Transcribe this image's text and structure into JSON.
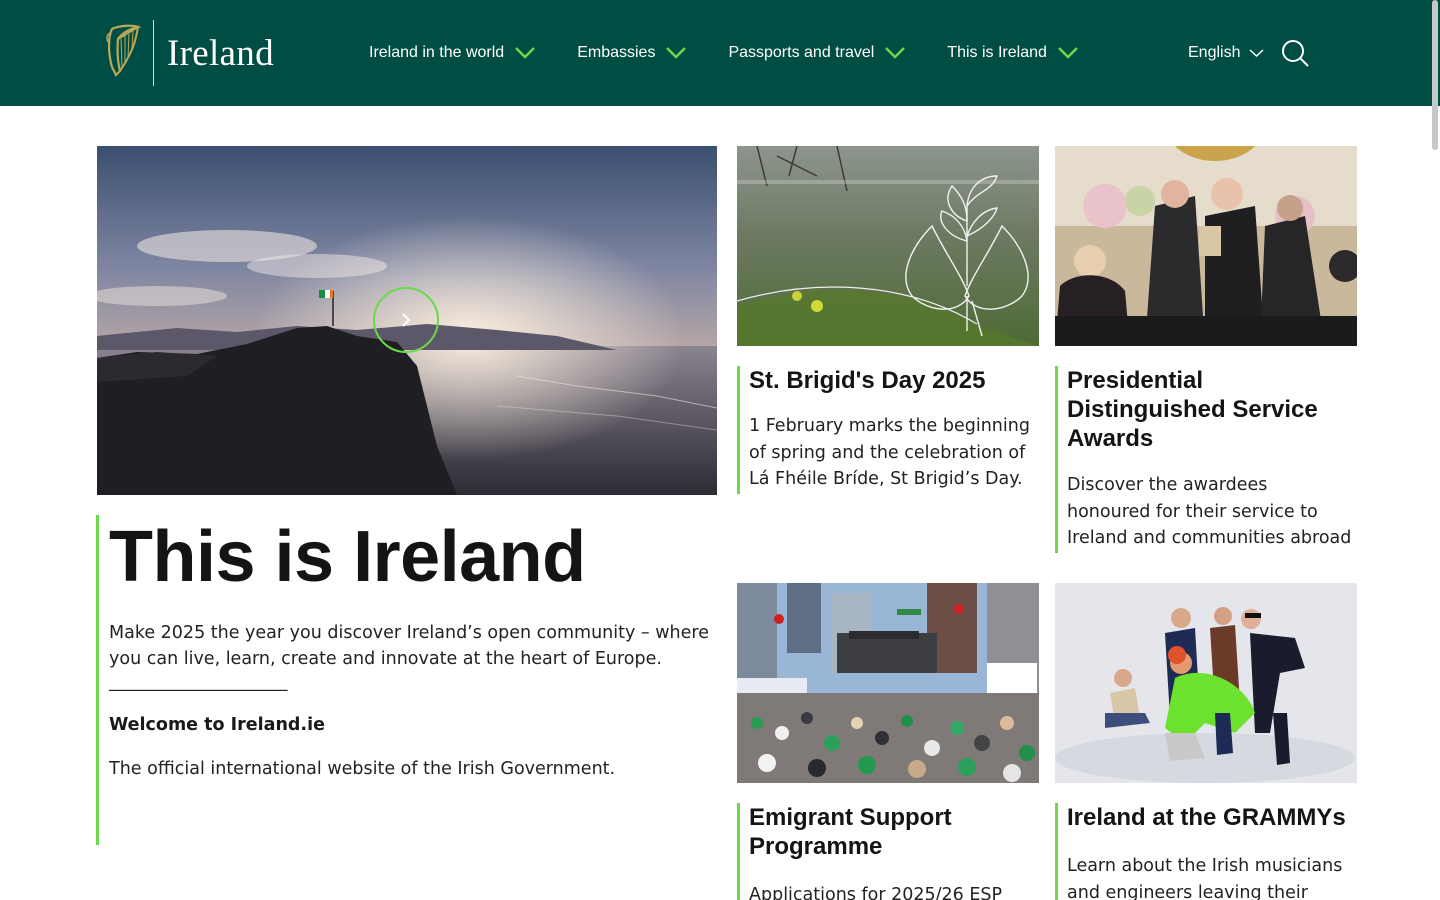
{
  "header": {
    "logo_text": "Ireland",
    "nav": [
      {
        "label": "Ireland in the world"
      },
      {
        "label": "Embassies"
      },
      {
        "label": "Passports and travel"
      },
      {
        "label": "This is Ireland"
      }
    ],
    "language": "English",
    "icons": {
      "logo": "harp-icon",
      "search": "search-icon",
      "dropdown": "chevron-down-icon"
    }
  },
  "hero": {
    "title": "This is Ireland",
    "description": "Make 2025 the year you discover Ireland’s open community – where you can live, learn, create and innovate at the heart of Europe.",
    "rule": "_____________________",
    "welcome": "Welcome to Ireland.ie",
    "official": "The official international website of the Irish Government.",
    "next_icon": "chevron-right-icon"
  },
  "cards": [
    {
      "title": "St. Brigid's Day 2025",
      "description": "1 February marks the beginning of spring and the celebration of Lá Fhéile Bríde, St Brigid’s Day."
    },
    {
      "title": "Presidential Distinguished Service Awards",
      "description": "Discover the awardees honoured for their service to Ireland and communities abroad"
    },
    {
      "title": "Emigrant Support Programme",
      "description": "Applications for 2025/26 ESP"
    },
    {
      "title": "Ireland at the GRAMMYs",
      "description": "Learn about the Irish musicians and engineers leaving their"
    }
  ],
  "colors": {
    "header_bg": "#004d44",
    "accent": "#6bd94b",
    "text": "#1a1a1a"
  }
}
